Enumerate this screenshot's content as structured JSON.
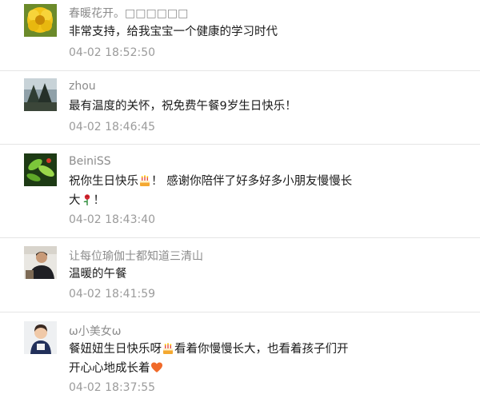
{
  "comments": [
    {
      "nickname": "春暖花开。□□□□□□",
      "content": "非常支持，给我宝宝一个健康的学习时代",
      "time": "04-02 18:52:50",
      "avatar": "yellow-flower-avatar"
    },
    {
      "nickname": "zhou",
      "content": "最有温度的关怀，祝免费午餐9岁生日快乐！",
      "time": "04-02 18:46:45",
      "avatar": "trees-photo-avatar"
    },
    {
      "nickname": "BeiniSS",
      "content_part1": "祝你生日快乐",
      "content_part2": "！ 感谢你陪伴了好多好多小朋友慢慢长",
      "content_part3": "大",
      "content_part4": "！",
      "time": "04-02 18:43:40",
      "avatar": "green-leaves-avatar"
    },
    {
      "nickname": "让每位瑜伽士都知道三清山",
      "content": "温暖的午餐",
      "time": "04-02 18:41:59",
      "avatar": "person-photo-avatar"
    },
    {
      "nickname": "ω小美女ω",
      "content_part1": "餐妞妞生日快乐呀",
      "content_part2": "看着你慢慢长大，也看着孩子们开",
      "content_part3": "开心心地成长着",
      "time": "04-02 18:37:55",
      "avatar": "child-photo-avatar"
    }
  ]
}
